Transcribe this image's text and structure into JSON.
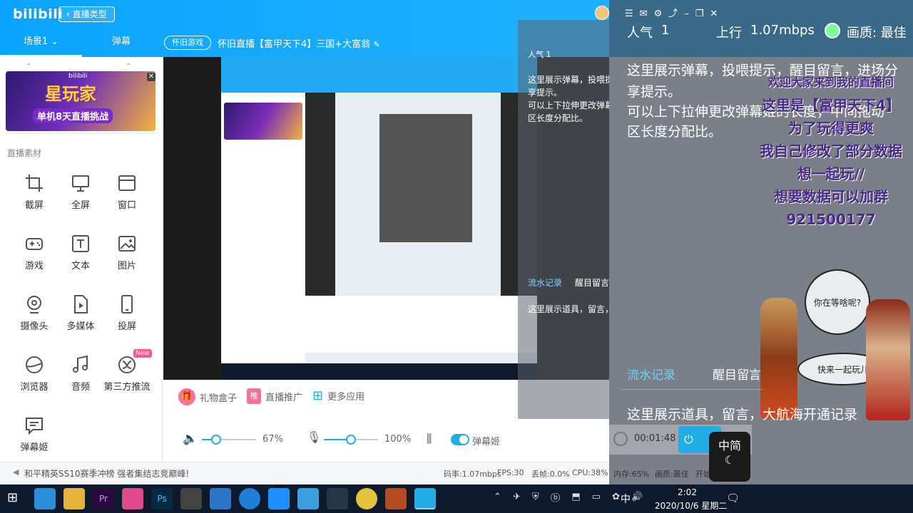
{
  "app": {
    "brand": "bilibili",
    "back_button": "直播类型",
    "scene_tab": "场景1",
    "danmu_tab": "弹幕"
  },
  "room": {
    "category": "怀旧游戏",
    "title": "怀旧直播【富甲天下4】三国+大富翁"
  },
  "banner": {
    "title": "星玩家",
    "subtitle": "单机8天直播挑战",
    "brand": "bilibili"
  },
  "sidebar": {
    "section_label": "直播素材",
    "tools": [
      {
        "label": "截屏",
        "icon": "crop-icon"
      },
      {
        "label": "全屏",
        "icon": "monitor-icon"
      },
      {
        "label": "窗口",
        "icon": "window-icon"
      },
      {
        "label": "游戏",
        "icon": "gamepad-icon"
      },
      {
        "label": "文本",
        "icon": "text-icon"
      },
      {
        "label": "图片",
        "icon": "image-icon"
      },
      {
        "label": "摄像头",
        "icon": "camera-icon"
      },
      {
        "label": "多媒体",
        "icon": "media-icon"
      },
      {
        "label": "投屏",
        "icon": "phone-icon"
      },
      {
        "label": "浏览器",
        "icon": "browser-icon"
      },
      {
        "label": "音频",
        "icon": "music-icon"
      },
      {
        "label": "第三方推流",
        "icon": "stream-icon"
      },
      {
        "label": "弹幕姬",
        "icon": "danmaku-icon"
      }
    ],
    "new_badge": "New"
  },
  "controls": {
    "gift_box": "礼物盒子",
    "promote": "直播推广",
    "more_apps": "更多应用",
    "speaker_volume": "67%",
    "speaker_level": 0.67,
    "mic_volume": "100%",
    "mic_level": 1.0,
    "danmaku_toggle": "弹幕姬"
  },
  "status": {
    "ticker": "和平精英SS10赛季冲榜 强者集结志竞巅峰!",
    "bitrate": "码率:1.07mbps",
    "fps": "FPS:30",
    "dropped": "丢帧:0.0%",
    "cpu": "CPU:38%",
    "memory": "内存:65%",
    "quality": "画质:最佳",
    "extra": "开始"
  },
  "overlay": {
    "popularity_label": "人气",
    "popularity_value": "1",
    "upload_label": "上行",
    "upload_value": "1.07mbps",
    "quality": "画质: 最佳",
    "info_line1": "这里展示弹幕，投喂提示，醒目留言，进场分",
    "info_line2": "享提示。",
    "info_line3": "可以上下拉伸更改弹幕姬的长度，中间拖动",
    "info_line4": "区长度分配比。",
    "tab_records": "流水记录",
    "tab_messages": "醒目留言",
    "records_text": "这里展示道具，留言，大航海开通记录",
    "timer": "00:01:48",
    "stream_banner": [
      "欢迎大家来到我的直播间",
      "这里是【富甲天下4】",
      "为了玩得更爽",
      "我自己修改了部分数据",
      "想一起玩//",
      "想要数据可以加群",
      "921500177"
    ],
    "bubble1": "你在等啥呢?",
    "bubble2": "快来一起玩儿",
    "ime_mode": "中简"
  },
  "mini_overlay": {
    "popularity": "人气 1",
    "upload": "上行 1.07mbps",
    "quality": "画质: 最佳",
    "drop": "丢帧 0.0%",
    "info1": "这里展示弹幕，投喂提",
    "info2": "享提示。",
    "info3": "可以上下拉伸更改弹幕",
    "info4": "区长度分配比。",
    "tab_records": "流水记录",
    "tab_messages": "醒目留言",
    "records_text": "这里展示道具，留言，大航海开通记录"
  },
  "taskbar": {
    "time": "2:02",
    "date": "2020/10/6 星期二",
    "ime": "中"
  },
  "colors": {
    "accent": "#23ade5",
    "topbar": "#11a9ff",
    "pink": "#fb7299",
    "taskbar": "#0e1a2c"
  }
}
